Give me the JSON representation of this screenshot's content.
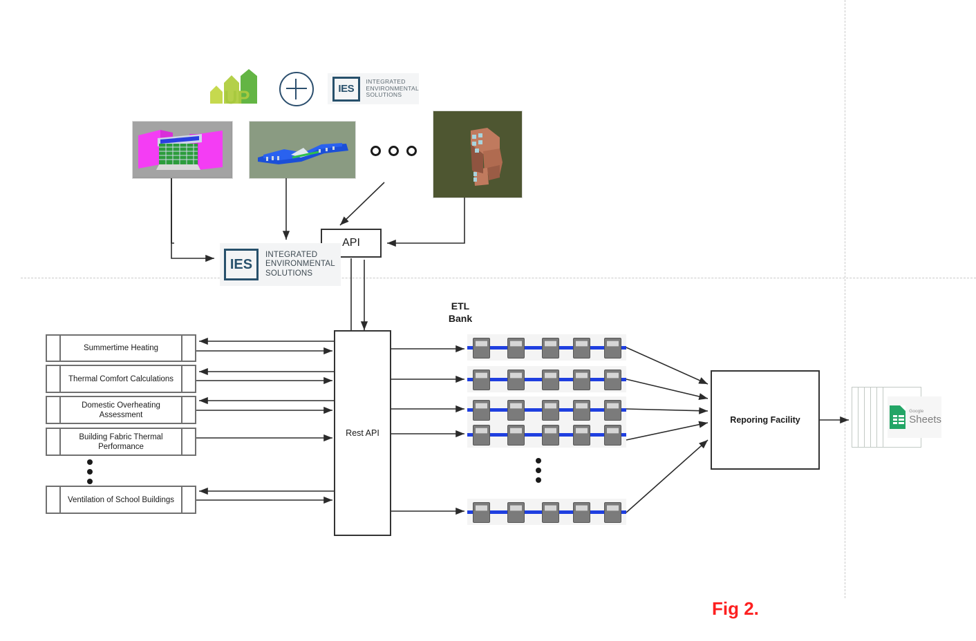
{
  "figure": {
    "caption": "Fig 2.",
    "caption_color": "#fd2020"
  },
  "top_section": {
    "up_logo_label": "UP",
    "plus_symbol": "+",
    "ies_logo_small": {
      "mark": "IES",
      "line1": "INTEGRATED",
      "line2": "ENVIRONMENTAL",
      "line3": "SOLUTIONS"
    },
    "ies_logo_large": {
      "mark": "IES",
      "line1": "INTEGRATED",
      "line2": "ENVIRONMENTAL",
      "line3": "SOLUTIONS"
    },
    "thumbnails": [
      {
        "name": "magenta-massing-model"
      },
      {
        "name": "blue-campus-model"
      },
      {
        "name": "brown-block-model"
      }
    ],
    "ellipsis_rings": 3,
    "api_box_label": "API"
  },
  "middle_section": {
    "rest_api_label": "Rest API",
    "calculations": [
      {
        "label": "Summertime Heating"
      },
      {
        "label": "Thermal Comfort Calculations"
      },
      {
        "label": "Domestic Overheating Assessment"
      },
      {
        "label": "Building Fabric Thermal Performance"
      },
      {
        "label": "Ventilation of School Buildings"
      }
    ],
    "list_ellipsis_dots": 3
  },
  "etl_section": {
    "title_line1": "ETL",
    "title_line2": "Bank",
    "rows": 5,
    "servers_per_row": 5,
    "bus_color": "#1f3fe0",
    "server_color": "#7b7b7b",
    "vertical_ellipsis_dots": 3
  },
  "output_section": {
    "reporting_label": "Reporing Facility",
    "sheets": {
      "brand_line1": "Google",
      "brand_line2": "Sheets",
      "stack_pages": 6,
      "icon_color": "#23a566"
    }
  }
}
